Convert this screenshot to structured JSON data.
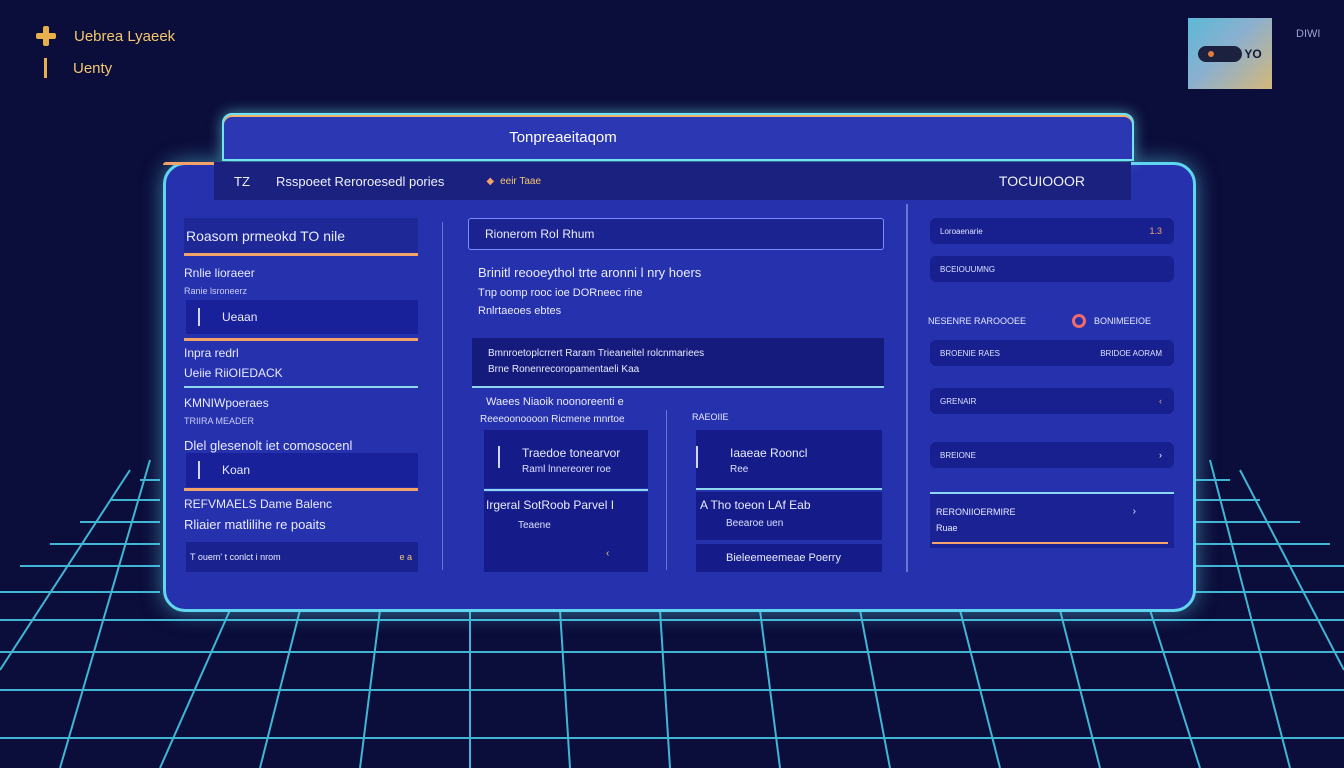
{
  "top_left": {
    "item1": "Uebrea Lyaeek",
    "item2": "Uenty"
  },
  "top_right": {
    "logo_text": "YO",
    "label": "DIWI"
  },
  "header": {
    "title": "Tonpreaeitaqom"
  },
  "toolbar": {
    "number": "TZ",
    "path": "Rsspoeet Reroroesedl pories",
    "link": "eeir Taae",
    "right": "TOCUIOOOR"
  },
  "left": {
    "heading": "Roasom prmeokd TO nile",
    "item1_title": "Rnlie lioraeer",
    "item1_sub": "Ranie lsroneerz",
    "box1": "Ueaan",
    "item2_title": "Inpra redrl",
    "item2_sub": "Ueiie RiiOIEDACK",
    "item3_title": "KMNIWpoeraes",
    "item3_sub": "TRIIRA MEADER",
    "item3_text": "Dlel glesenolt iet comosocenl",
    "box2": "Koan",
    "item4_title": "REFVMAELS Dame Balenc",
    "item4_text": "Rliaier matlilihe re poaits",
    "footer": "T ouem' t conlct i nrom",
    "footer_end": "e a"
  },
  "center": {
    "heading": "Rionerom RoI Rhum",
    "line1": "Brinitl reooeythol trte aronni l nry hoers",
    "line2": "Tnp oomp rooc ioe DORneec rine",
    "line3": "Rnlrtaeoes ebtes",
    "box_line1": "Bmnroetoplcrrert Raram Trieaneitel rolcnmariees",
    "box_line2": "Brne Ronenrecoropamentaeli Kaa",
    "label_left": "Waees Niaoik noonoreenti e",
    "label_left_sub": "Reeeoonoooon  Ricmene mnrtoe",
    "label_right": "RAEOIIE",
    "card1_title": "Traedoe tonearvor",
    "card1_sub": "Raml lnnereorer roe",
    "card2_title": "Irgeral SotRoob Parvel I",
    "card2_sub": "Teaene",
    "card3_title": "Iaaeae Rooncl",
    "card3_sub": "Ree",
    "card4_title": "A Tho toeon LAf Eab",
    "card4_sub": "Beearoe uen",
    "card5_title": "Bieleemeemeae Poerry",
    "arrow1": "‹",
    "arrow2": "‹"
  },
  "right": {
    "pill1": "Loroaenarie",
    "pill1_end": "1.3",
    "pill2": "BCEIOUUMNG",
    "section_left": "NESENRE RAROOOEE",
    "section_right": "BONIMEEIOE",
    "pill3": "BROENIE RAES",
    "pill3_end": "BRIDOE AORAM",
    "pill4": "GRENAIR",
    "pill4_end": "‹",
    "pill5": "BREIONE",
    "pill5_end": "›",
    "long_line1": "RERONIIOERMIRE",
    "long_line2": "Ruae",
    "long_chev": "›"
  },
  "colors": {
    "background": "#0b0d3a",
    "panel": "#2631ad",
    "glow": "#5fd5f0",
    "accent": "#f3a36a",
    "gold": "#f3c86d"
  }
}
